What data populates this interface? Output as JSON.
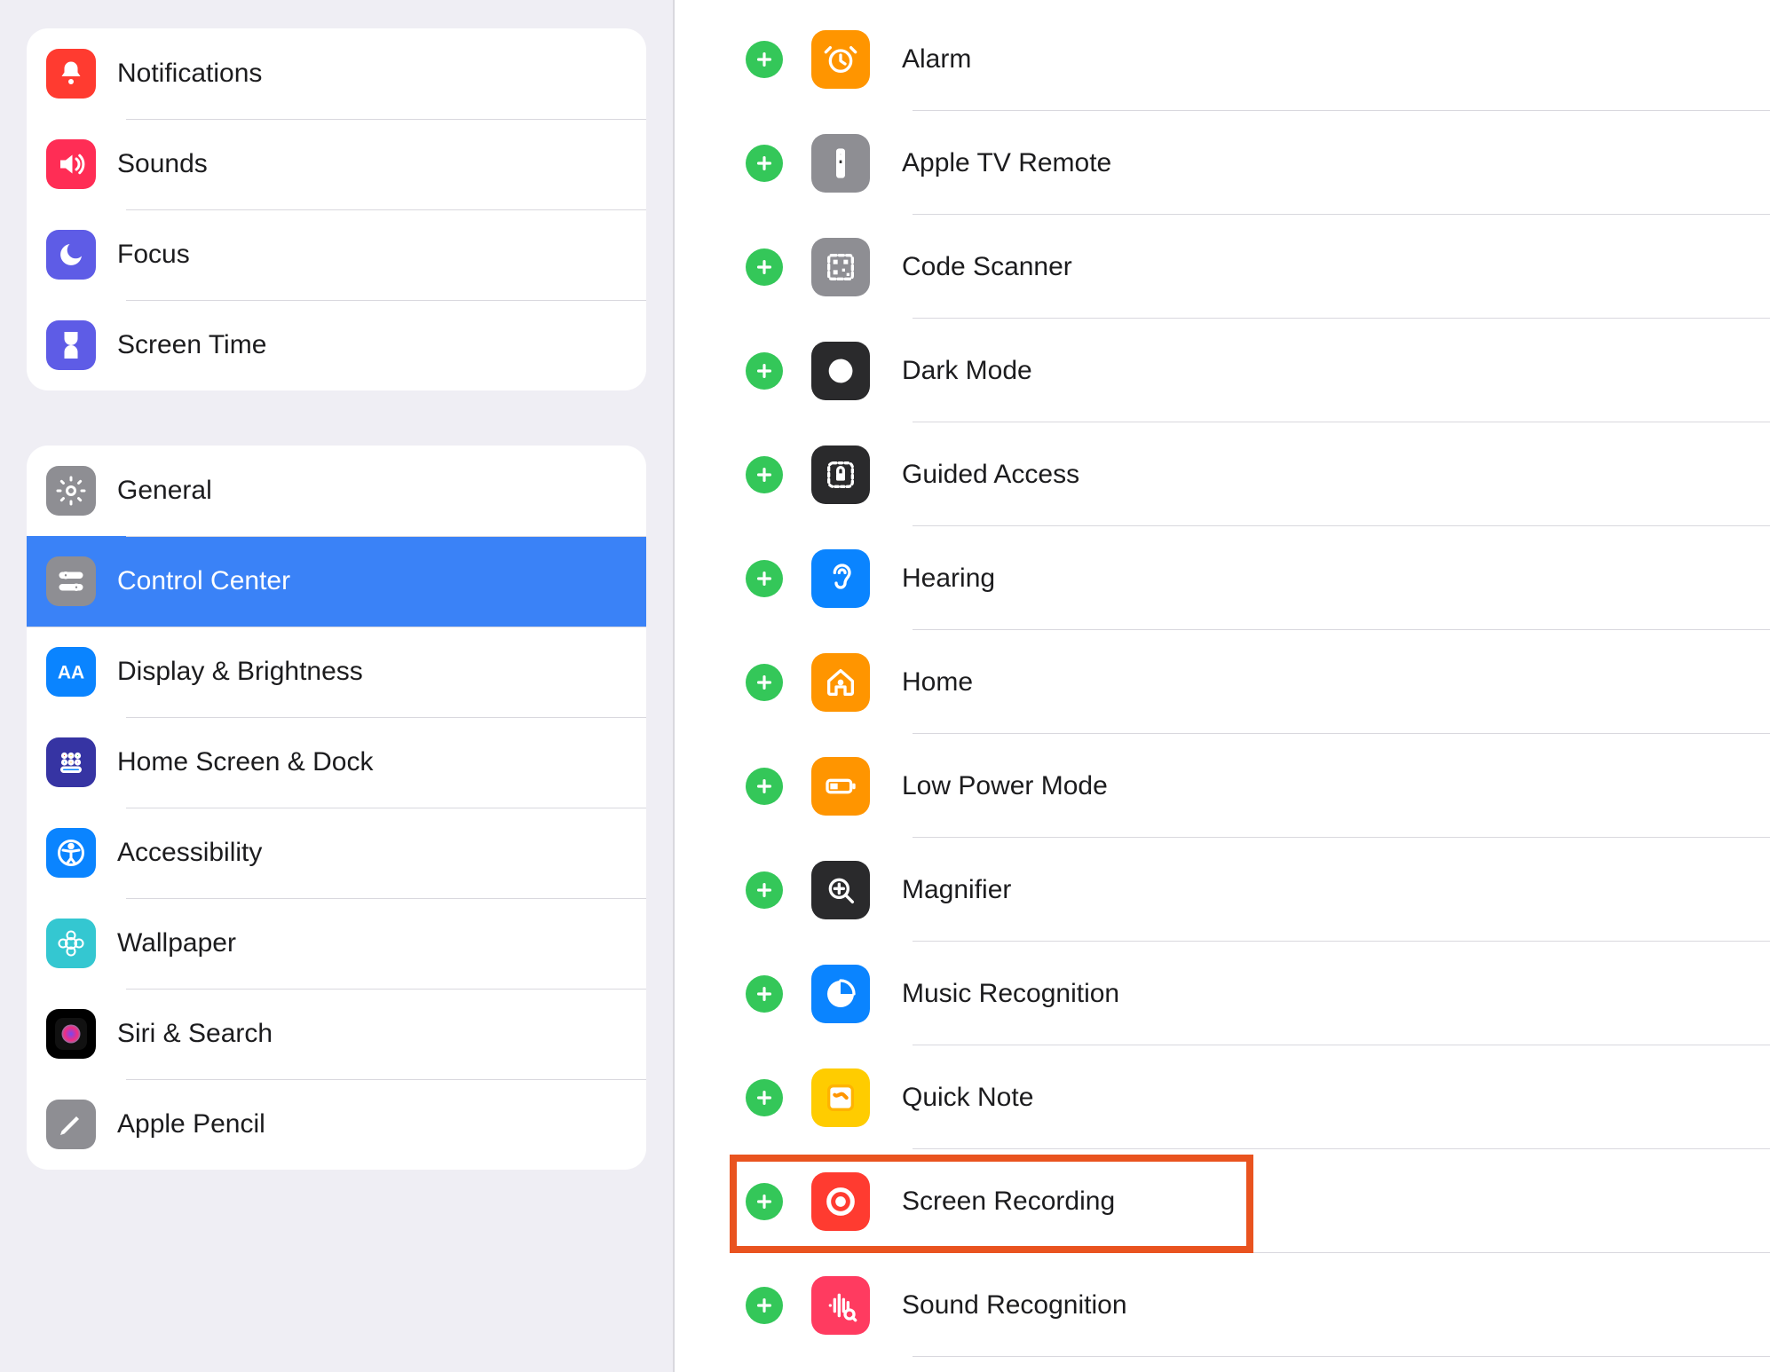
{
  "sidebar": {
    "group1": [
      {
        "id": "notifications",
        "label": "Notifications",
        "color": "#ff3b30"
      },
      {
        "id": "sounds",
        "label": "Sounds",
        "color": "#ff2d55"
      },
      {
        "id": "focus",
        "label": "Focus",
        "color": "#5e5ce6"
      },
      {
        "id": "screentime",
        "label": "Screen Time",
        "color": "#5e5ce6"
      }
    ],
    "group2": [
      {
        "id": "general",
        "label": "General",
        "color": "#8e8e93"
      },
      {
        "id": "controlcenter",
        "label": "Control Center",
        "color": "#8e8e93",
        "selected": true
      },
      {
        "id": "display",
        "label": "Display & Brightness",
        "color": "#0a84ff"
      },
      {
        "id": "homescreen",
        "label": "Home Screen & Dock",
        "color": "#3634a3"
      },
      {
        "id": "accessibility",
        "label": "Accessibility",
        "color": "#0a84ff"
      },
      {
        "id": "wallpaper",
        "label": "Wallpaper",
        "color": "#34c7d1"
      },
      {
        "id": "siri",
        "label": "Siri & Search",
        "color": "siri"
      },
      {
        "id": "pencil",
        "label": "Apple Pencil",
        "color": "#8e8e93"
      }
    ]
  },
  "controls": [
    {
      "id": "alarm",
      "label": "Alarm",
      "color": "#ff9500"
    },
    {
      "id": "tvremote",
      "label": "Apple TV Remote",
      "color": "#8e8e93"
    },
    {
      "id": "codescanner",
      "label": "Code Scanner",
      "color": "#8e8e93"
    },
    {
      "id": "darkmode",
      "label": "Dark Mode",
      "color": "#2a2a2c"
    },
    {
      "id": "guidedaccess",
      "label": "Guided Access",
      "color": "#2a2a2c"
    },
    {
      "id": "hearing",
      "label": "Hearing",
      "color": "#0a84ff"
    },
    {
      "id": "home",
      "label": "Home",
      "color": "#ff9500"
    },
    {
      "id": "lowpower",
      "label": "Low Power Mode",
      "color": "#ff9500"
    },
    {
      "id": "magnifier",
      "label": "Magnifier",
      "color": "#2a2a2c"
    },
    {
      "id": "musicrec",
      "label": "Music Recognition",
      "color": "#0a84ff"
    },
    {
      "id": "quicknote",
      "label": "Quick Note",
      "color": "#ffcc00"
    },
    {
      "id": "screenrec",
      "label": "Screen Recording",
      "color": "#ff3b30",
      "highlighted": true
    },
    {
      "id": "soundrec",
      "label": "Sound Recognition",
      "color": "#ff3b60"
    }
  ]
}
